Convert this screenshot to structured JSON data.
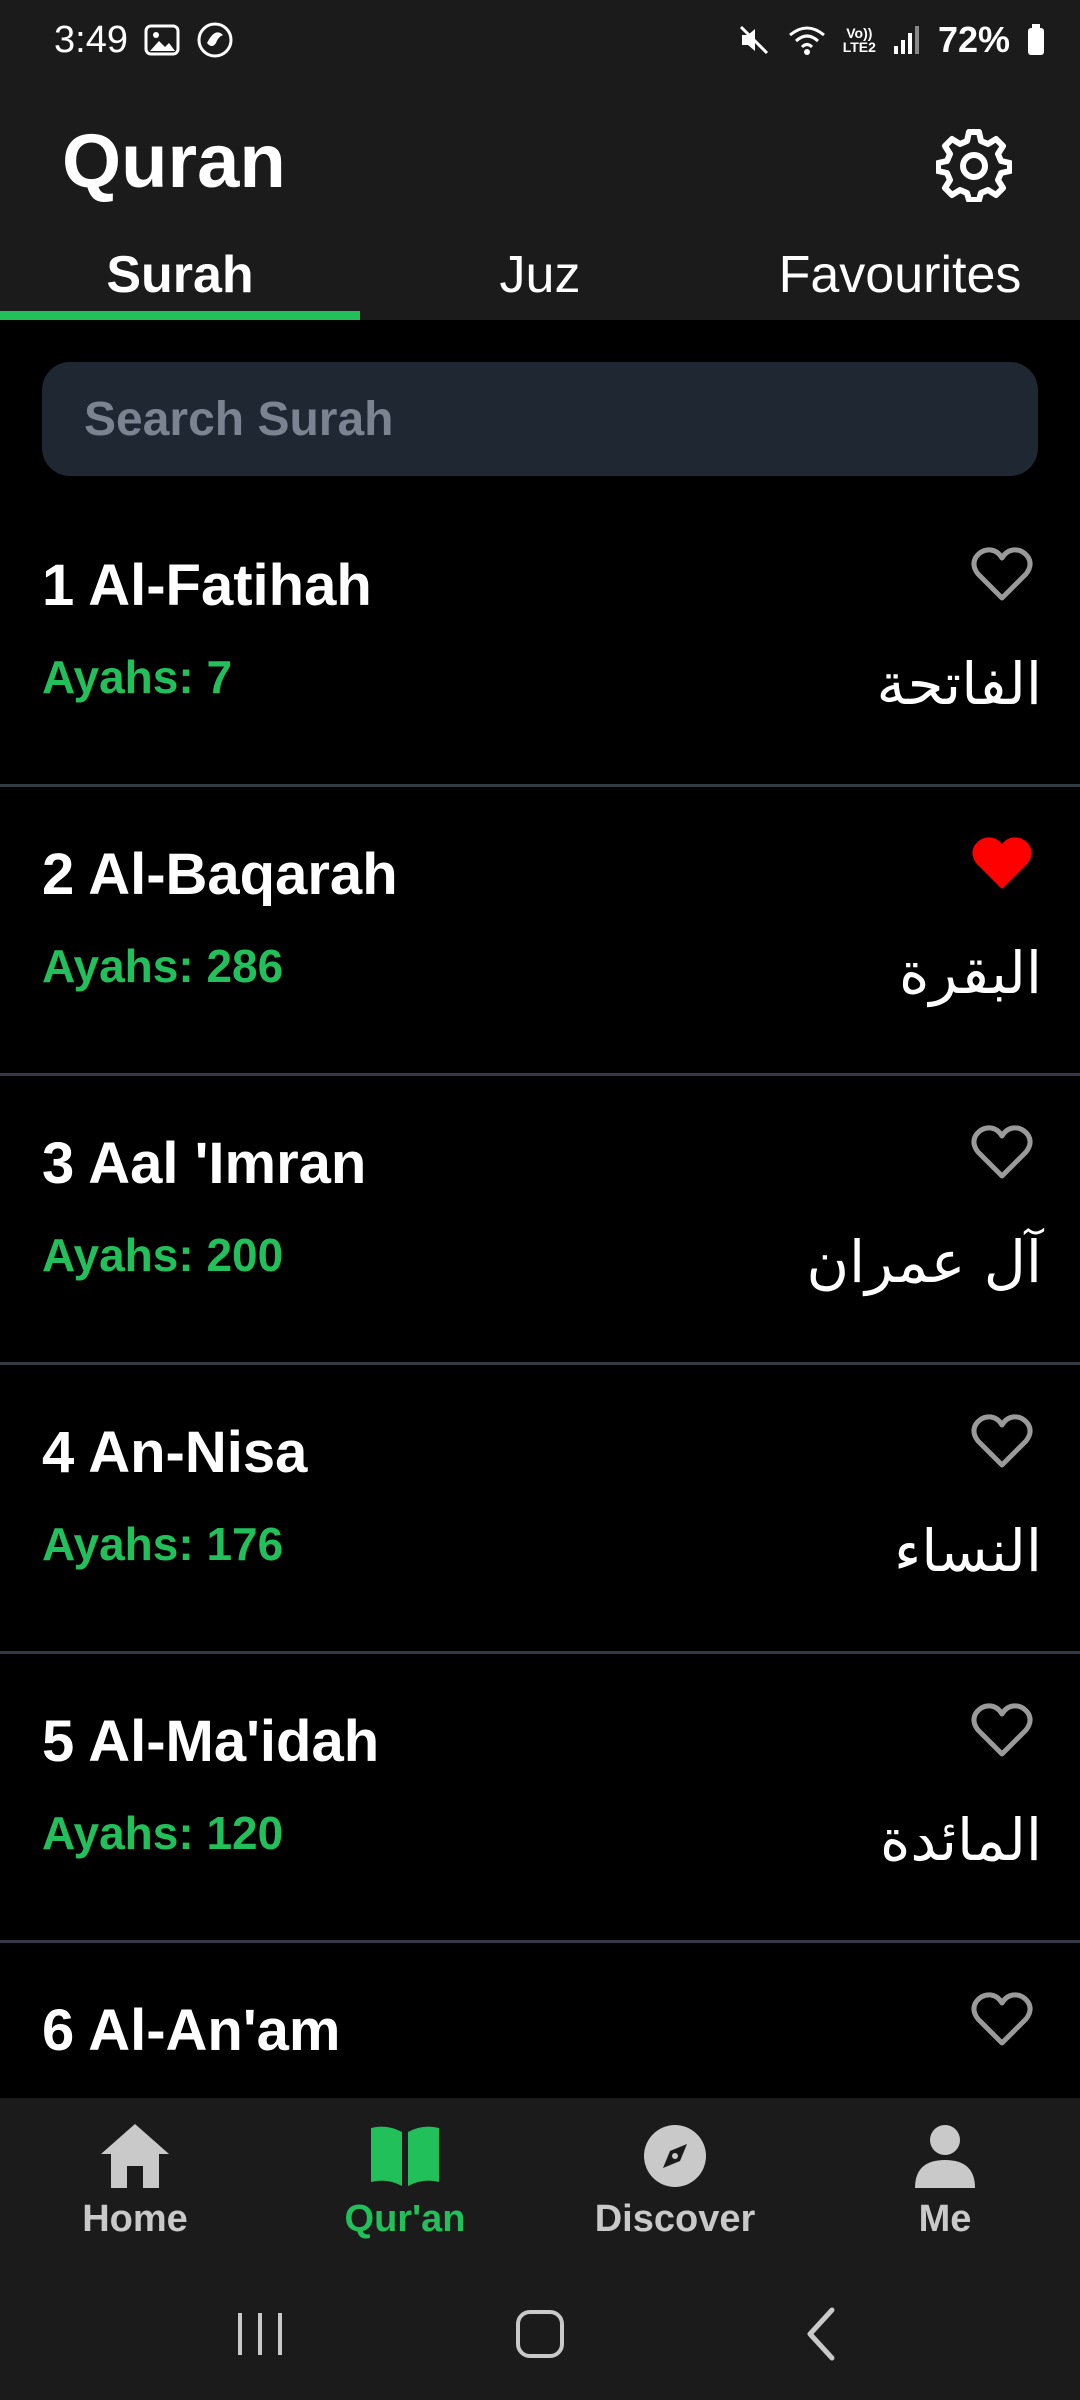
{
  "status_bar": {
    "time": "3:49",
    "battery_percent": "72%",
    "network_lte_top": "Vo))",
    "network_lte_bottom": "LTE2"
  },
  "header": {
    "title": "Quran",
    "tabs": [
      {
        "label": "Surah",
        "active": true
      },
      {
        "label": "Juz",
        "active": false
      },
      {
        "label": "Favourites",
        "active": false
      }
    ]
  },
  "search": {
    "placeholder": "Search Surah"
  },
  "surahs": [
    {
      "title": "1 Al-Fatihah",
      "ayahs": "Ayahs: 7",
      "arabic": "الفاتحة",
      "favourite": false
    },
    {
      "title": "2 Al-Baqarah",
      "ayahs": "Ayahs: 286",
      "arabic": "البقرة",
      "favourite": true
    },
    {
      "title": "3 Aal 'Imran",
      "ayahs": "Ayahs: 200",
      "arabic": "آل عمران",
      "favourite": false
    },
    {
      "title": "4 An-Nisa",
      "ayahs": "Ayahs: 176",
      "arabic": "النساء",
      "favourite": false
    },
    {
      "title": "5 Al-Ma'idah",
      "ayahs": "Ayahs: 120",
      "arabic": "المائدة",
      "favourite": false
    },
    {
      "title": "6 Al-An'am",
      "ayahs": "",
      "arabic": "",
      "favourite": false
    }
  ],
  "bottom_nav": [
    {
      "label": "Home",
      "icon": "home-icon",
      "active": false
    },
    {
      "label": "Qur'an",
      "icon": "book-icon",
      "active": true
    },
    {
      "label": "Discover",
      "icon": "compass-icon",
      "active": false
    },
    {
      "label": "Me",
      "icon": "person-icon",
      "active": false
    }
  ],
  "colors": {
    "accent": "#22c05a",
    "favourite": "#ff0000",
    "background": "#000000",
    "surface": "#1b1b1b",
    "search_bg": "#1f2733"
  }
}
